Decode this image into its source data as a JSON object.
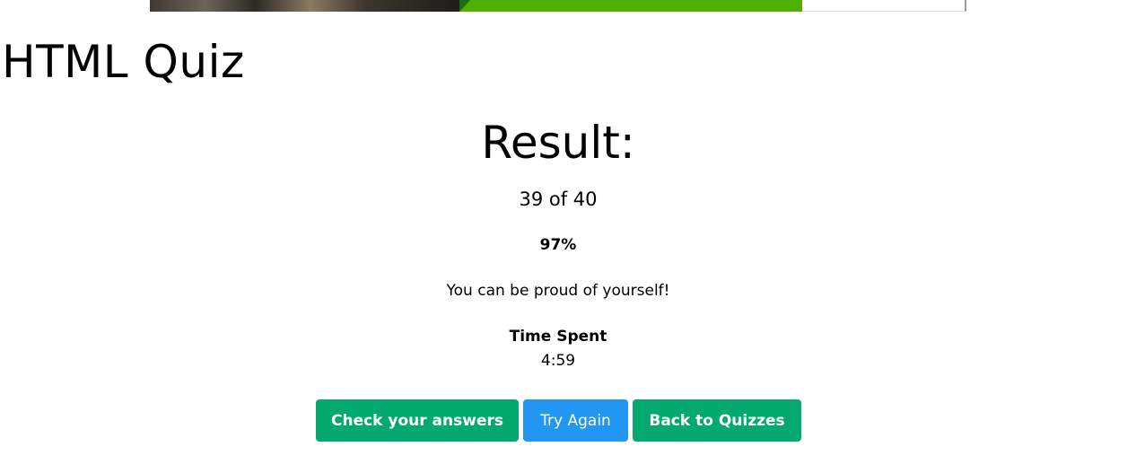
{
  "colors": {
    "primary_green": "#04aa6d",
    "try_again_blue": "#2196f3",
    "banner_green": "#4fb000",
    "text": "#000000",
    "background": "#ffffff"
  },
  "page": {
    "title": "HTML Quiz"
  },
  "result": {
    "heading": "Result:",
    "score": "39 of 40",
    "percentage": "97%",
    "message": "You can be proud of yourself!",
    "time_label": "Time Spent",
    "time_value": "4:59"
  },
  "actions": {
    "check_answers": "Check your answers",
    "try_again": "Try Again",
    "back_to_quizzes": "Back to Quizzes"
  }
}
